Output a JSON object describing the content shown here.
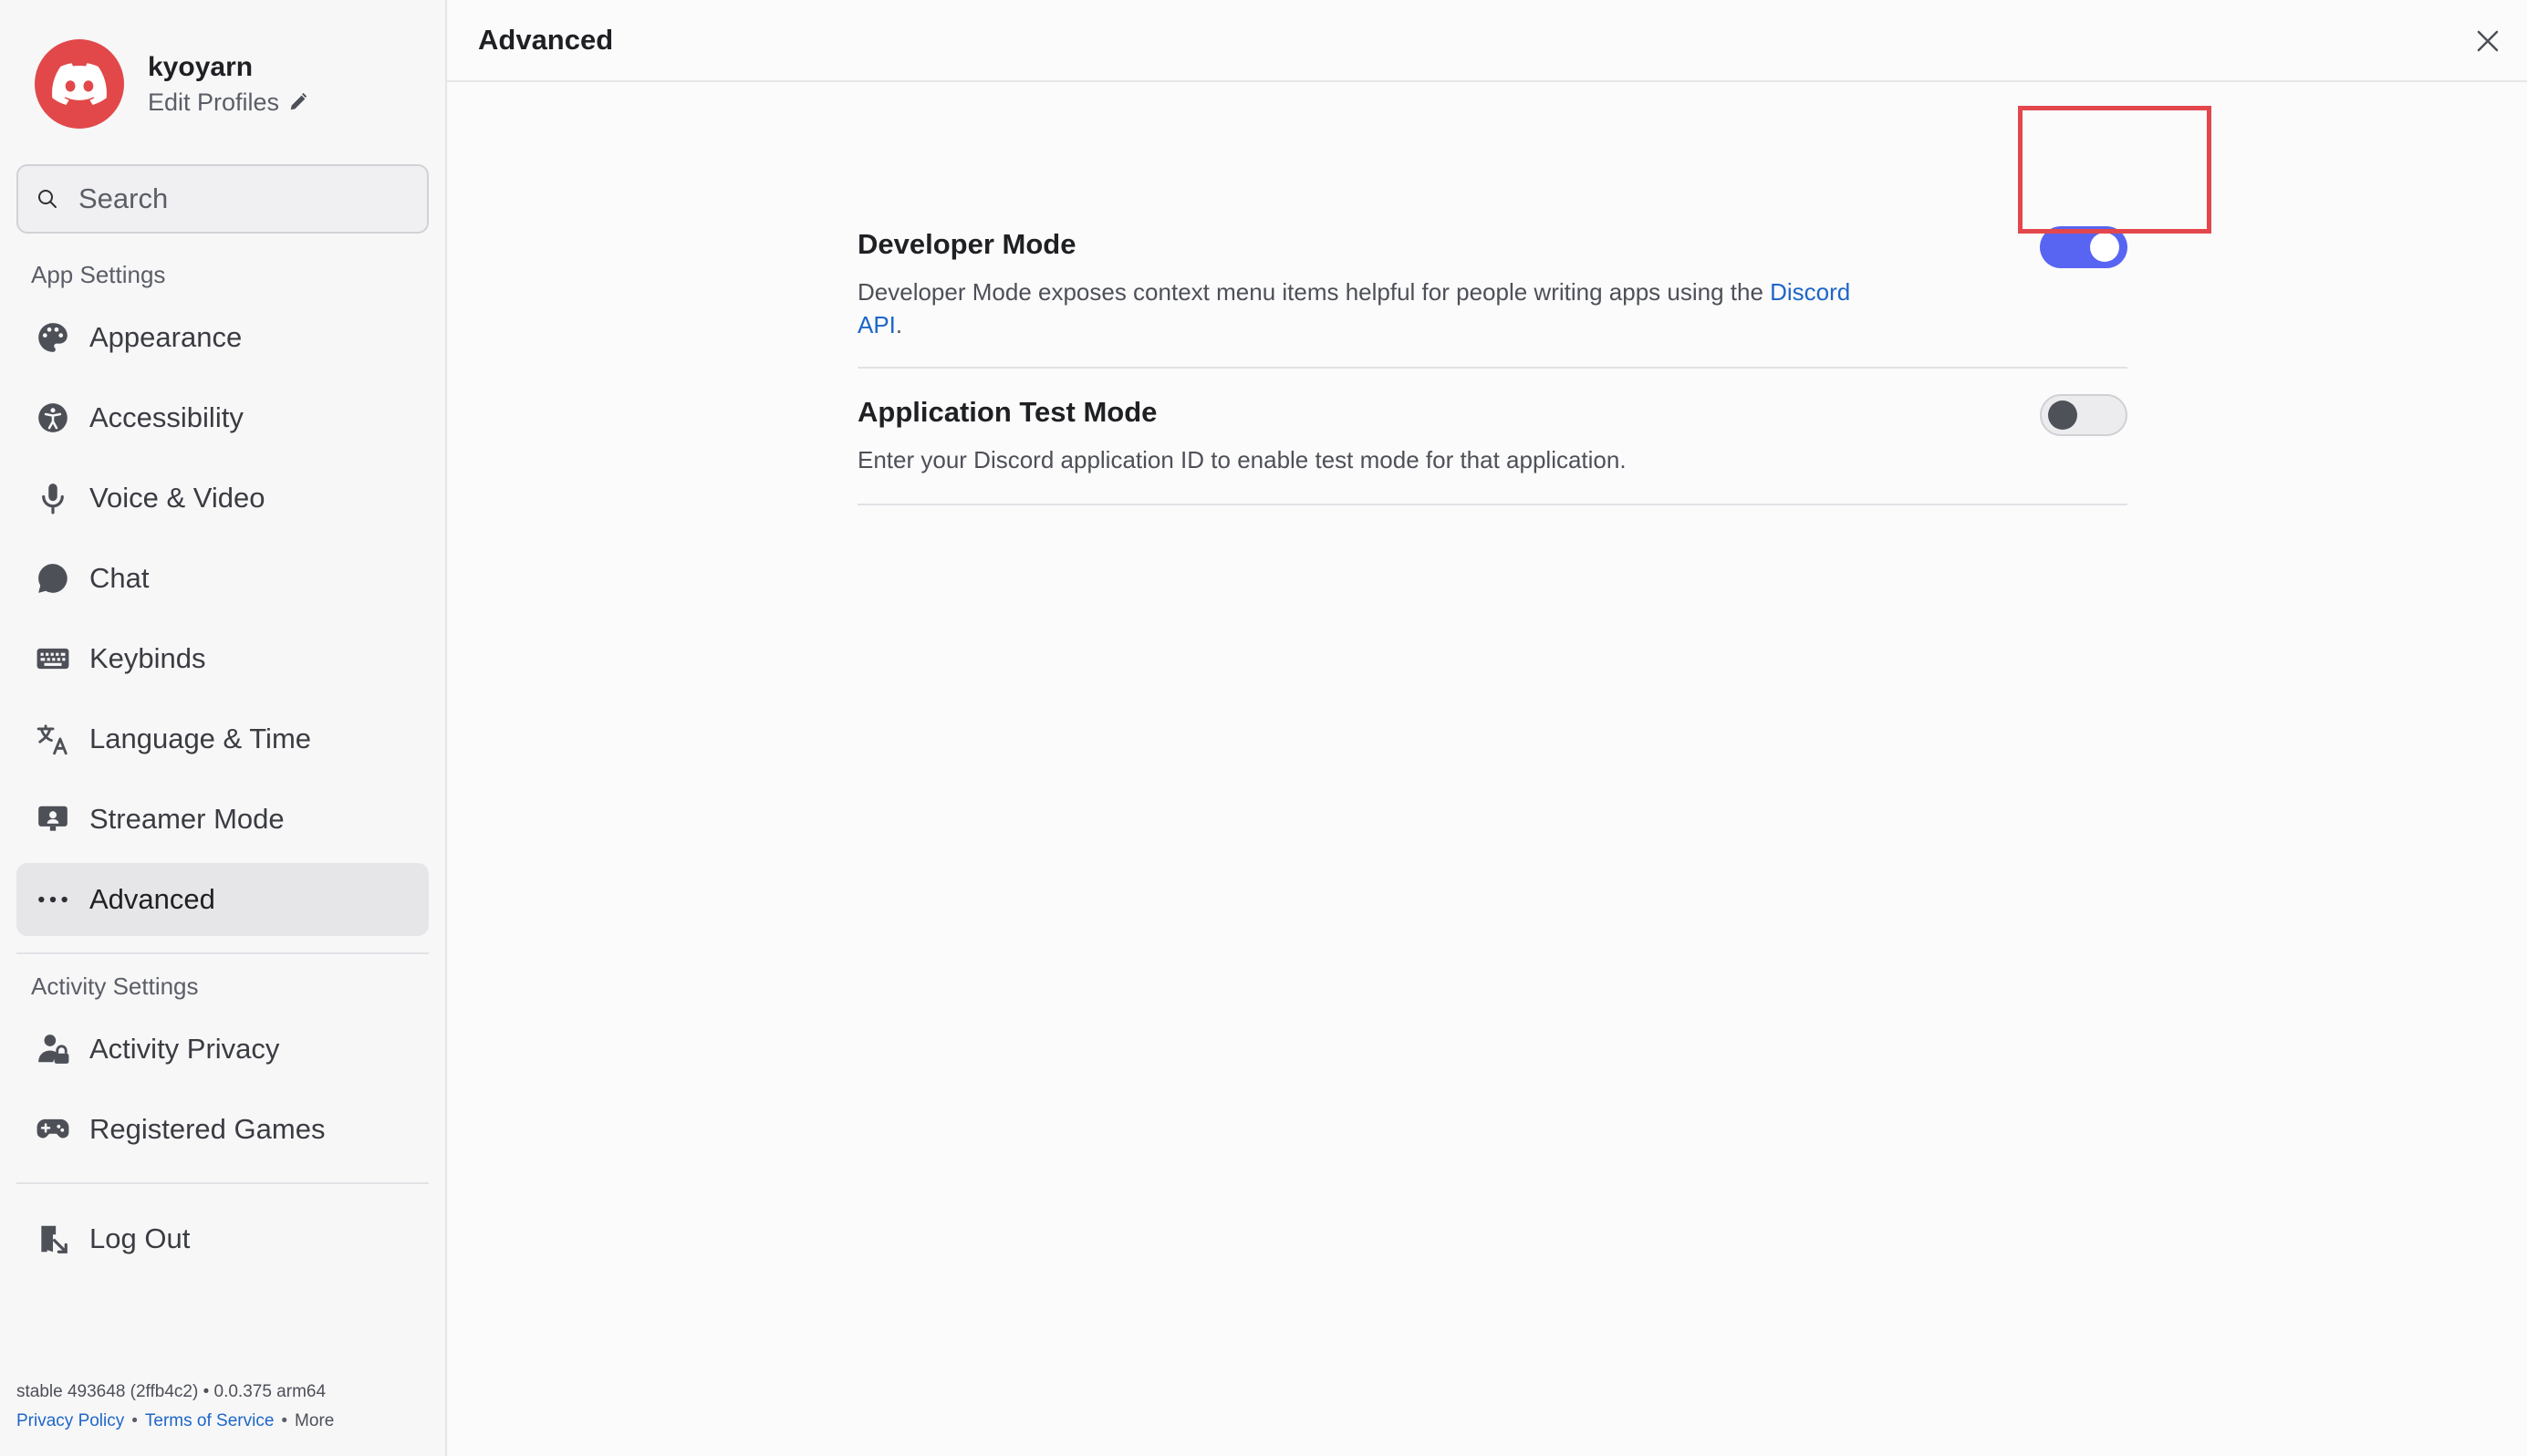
{
  "profile": {
    "username": "kyoyarn",
    "edit_label": "Edit Profiles"
  },
  "search": {
    "placeholder": "Search"
  },
  "sections": {
    "app_settings": "App Settings",
    "activity_settings": "Activity Settings"
  },
  "nav": {
    "appearance": "Appearance",
    "accessibility": "Accessibility",
    "voice_video": "Voice & Video",
    "chat": "Chat",
    "keybinds": "Keybinds",
    "language_time": "Language & Time",
    "streamer_mode": "Streamer Mode",
    "advanced": "Advanced",
    "activity_privacy": "Activity Privacy",
    "registered_games": "Registered Games",
    "log_out": "Log Out"
  },
  "footer": {
    "build": "stable 493648 (2ffb4c2) • 0.0.375 arm64",
    "privacy": "Privacy Policy",
    "terms": "Terms of Service",
    "more": "More"
  },
  "page": {
    "title": "Advanced"
  },
  "settings": {
    "developer_mode": {
      "title": "Developer Mode",
      "desc": "Developer Mode exposes context menu items helpful for people writing apps using the ",
      "link": "Discord API",
      "desc_end": ".",
      "enabled": true
    },
    "app_test_mode": {
      "title": "Application Test Mode",
      "desc": "Enter your Discord application ID to enable test mode for that application.",
      "enabled": false
    }
  },
  "colors": {
    "accent": "#5865f2",
    "brand": "#e2484a",
    "highlight": "#e3474d",
    "link": "#1e66c7"
  }
}
